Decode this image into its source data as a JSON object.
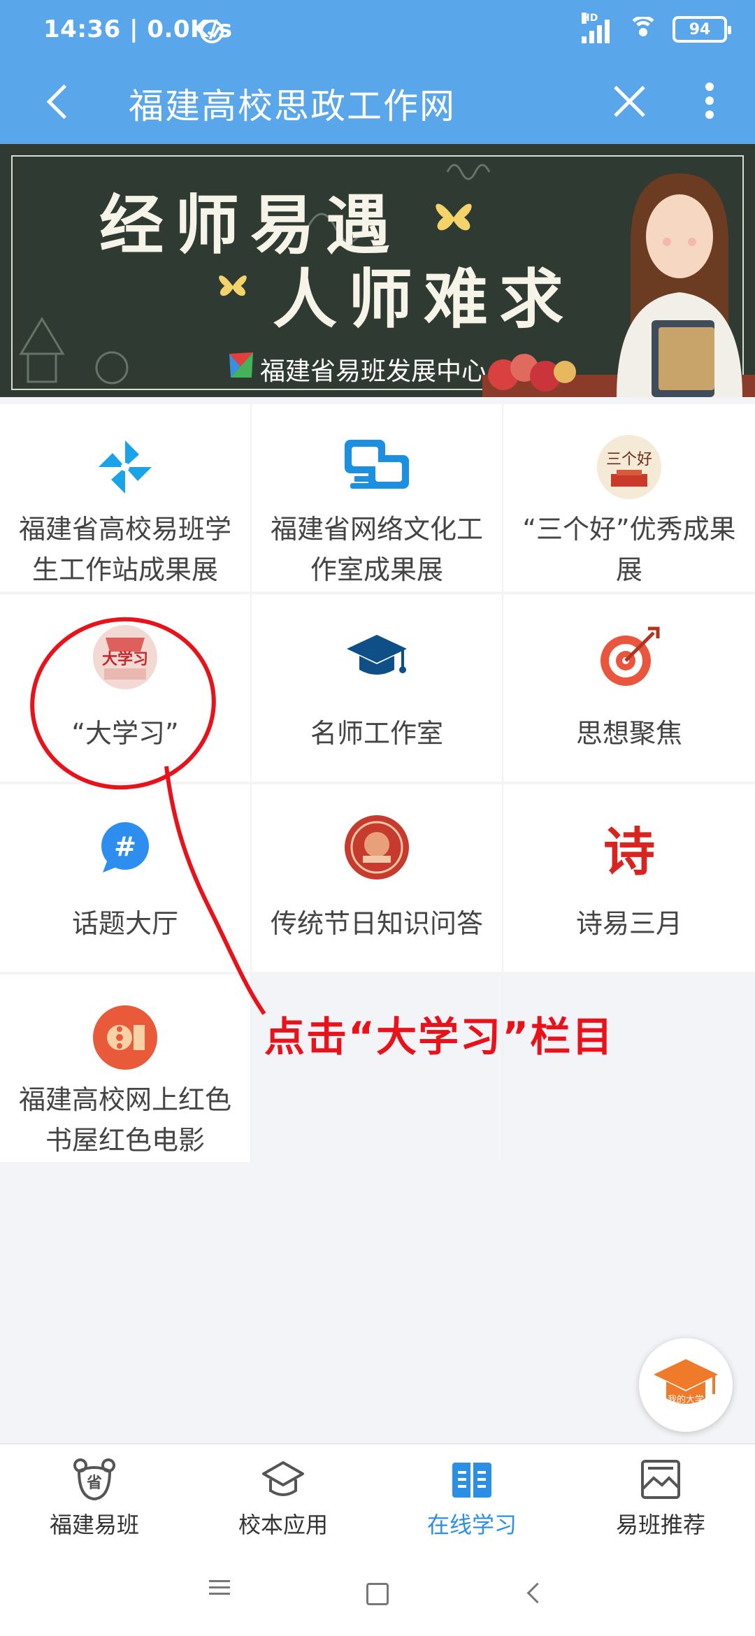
{
  "status_bar": {
    "time": "14:36 | 0.0K/s",
    "network_type": "HD",
    "battery": "94"
  },
  "nav": {
    "title": "福建高校思政工作网"
  },
  "banner": {
    "line1": "经师易遇",
    "line2": "人师难求",
    "subtitle": "福建省易班发展中心"
  },
  "grid": {
    "items": [
      {
        "label": "福建省高校易班学生工作站成果展",
        "icon": "pinwheel-icon"
      },
      {
        "label": "福建省网络文化工作室成果展",
        "icon": "network-monitor-icon"
      },
      {
        "label": "“三个好”优秀成果展",
        "icon": "three-good-badge-icon",
        "icon_text": "三个好"
      },
      {
        "label": "“大学习”",
        "icon": "daxuexi-badge-icon",
        "icon_text": "大学习"
      },
      {
        "label": "名师工作室",
        "icon": "graduation-cap-icon"
      },
      {
        "label": "思想聚焦",
        "icon": "target-icon"
      },
      {
        "label": "话题大厅",
        "icon": "hashtag-chat-icon"
      },
      {
        "label": "传统节日知识问答",
        "icon": "festival-medallion-icon"
      },
      {
        "label": "诗易三月",
        "icon": "poem-character-icon",
        "icon_text": "诗"
      },
      {
        "label": "福建高校网上红色书屋红色电影",
        "icon": "film-reel-icon"
      }
    ]
  },
  "annotation": {
    "text": "点击“大学习”栏目",
    "color": "#e8121a"
  },
  "fab": {
    "label": "我的大学",
    "icon": "graduation-cap-icon"
  },
  "tabs": [
    {
      "label": "福建易班",
      "icon": "bear-badge-icon",
      "icon_text": "省",
      "active": false
    },
    {
      "label": "校本应用",
      "icon": "graduation-cap-outline-icon",
      "active": false
    },
    {
      "label": "在线学习",
      "icon": "open-book-icon",
      "active": true
    },
    {
      "label": "易班推荐",
      "icon": "picture-frame-icon",
      "active": false
    }
  ],
  "colors": {
    "header_blue": "#5aa6ea",
    "active_tab": "#2b8fe6",
    "annotation_red": "#e8121a"
  }
}
